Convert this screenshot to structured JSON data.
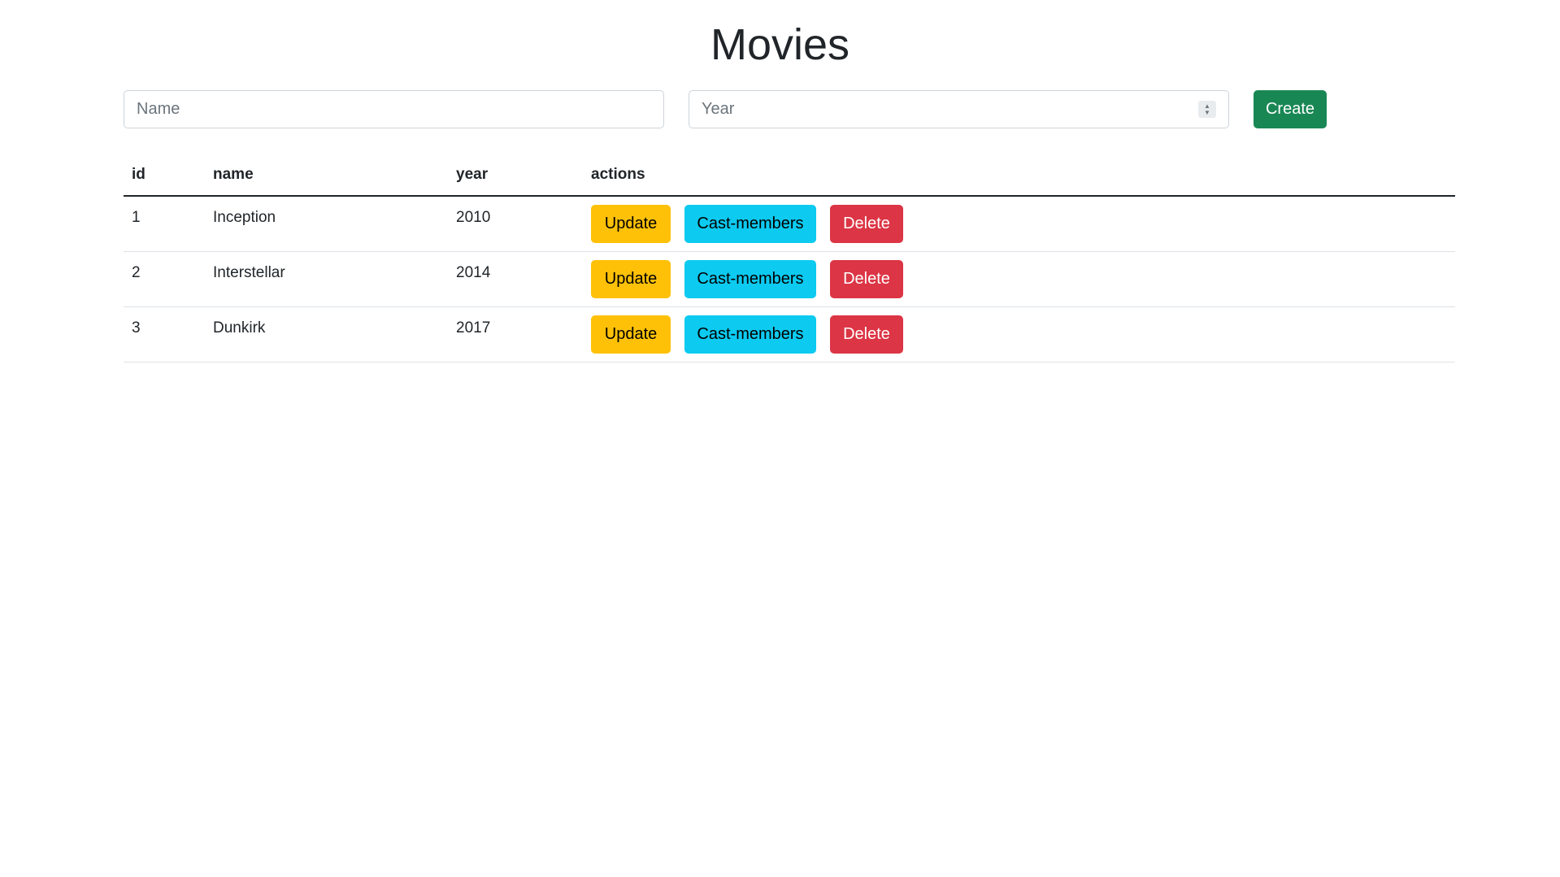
{
  "page": {
    "title": "Movies"
  },
  "form": {
    "name_placeholder": "Name",
    "name_value": "",
    "year_placeholder": "Year",
    "year_value": "",
    "create_label": "Create"
  },
  "table": {
    "columns": [
      "id",
      "name",
      "year",
      "actions"
    ],
    "rows": [
      {
        "id": "1",
        "name": "Inception",
        "year": "2010"
      },
      {
        "id": "2",
        "name": "Interstellar",
        "year": "2014"
      },
      {
        "id": "3",
        "name": "Dunkirk",
        "year": "2017"
      }
    ],
    "actions": {
      "update_label": "Update",
      "cast_label": "Cast-members",
      "delete_label": "Delete"
    }
  },
  "colors": {
    "create": "#198754",
    "update": "#ffc107",
    "cast": "#0dcaf0",
    "delete": "#dc3545"
  },
  "icons": {
    "year_spinner": "spinner-up-down-icon"
  }
}
